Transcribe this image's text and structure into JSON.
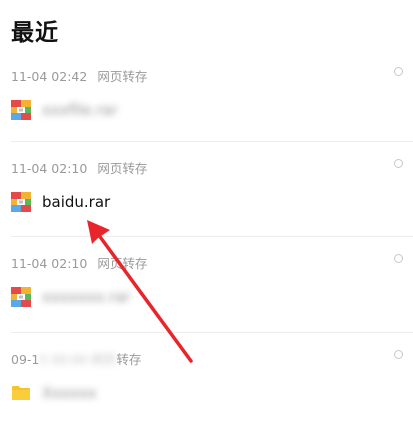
{
  "title": "最近",
  "items": [
    {
      "date": "11-04 02:42",
      "source": "网页转存",
      "name": "xxxfile.rar",
      "icon": "rar-archive-icon"
    },
    {
      "date": "11-04 02:10",
      "source": "网页转存",
      "name": "baidu.rar",
      "icon": "rar-archive-icon"
    },
    {
      "date": "11-04 02:10",
      "source": "网页转存",
      "name": "xxxxxxx.rar",
      "icon": "rar-archive-icon"
    },
    {
      "date": "09-1",
      "date_hidden": "5 00:00 网页",
      "source": "转存",
      "name": "Xxxxxx",
      "icon": "folder-icon"
    }
  ],
  "colors": {
    "arrow": "#e8252b",
    "folder": "#f6c12b",
    "rar_top": "#e44a4a",
    "rar_mid": "#f2b234",
    "rar_bottom": "#5aa8e6",
    "rar_right": "#59b85a"
  }
}
